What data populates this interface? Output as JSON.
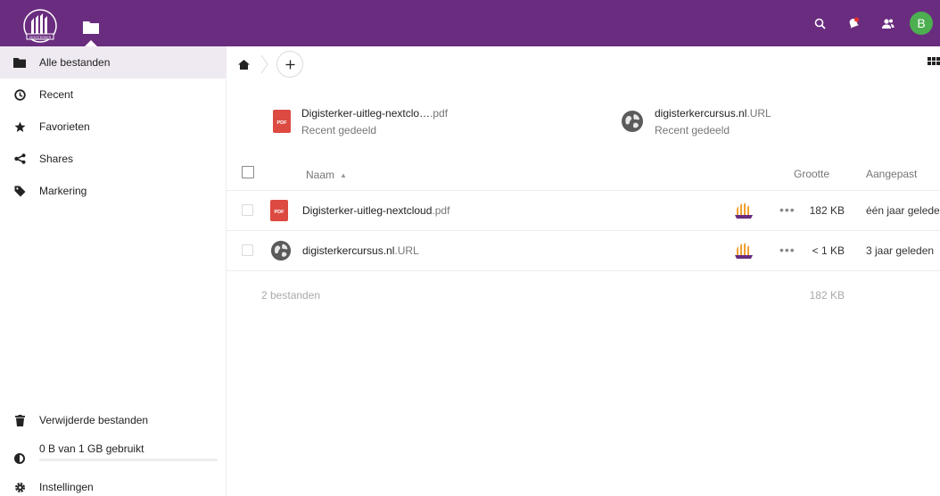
{
  "header": {
    "logo_text": "DIGISTERKER",
    "avatar_initial": "B",
    "icons": [
      "search-icon",
      "notifications-icon",
      "contacts-icon"
    ],
    "colors": {
      "primary": "#6a2c7f",
      "avatar": "#4caf50",
      "notification_dot": "#e9322d"
    }
  },
  "sidebar": {
    "items": [
      {
        "label": "Alle bestanden",
        "icon": "folder-icon",
        "active": true
      },
      {
        "label": "Recent",
        "icon": "clock-icon"
      },
      {
        "label": "Favorieten",
        "icon": "star-icon"
      },
      {
        "label": "Shares",
        "icon": "share-icon"
      },
      {
        "label": "Markering",
        "icon": "tag-icon"
      }
    ],
    "deleted_label": "Verwijderde bestanden",
    "quota_label": "0 B van 1 GB gebruikt",
    "quota_fraction": 0,
    "settings_label": "Instellingen"
  },
  "recent": [
    {
      "name": "Digisterker-uitleg-nextclo…",
      "ext": ".pdf",
      "sub": "Recent gedeeld",
      "icon": "pdf-icon"
    },
    {
      "name": "digisterkercursus.nl",
      "ext": ".URL",
      "sub": "Recent gedeeld",
      "icon": "globe-icon"
    }
  ],
  "table": {
    "headers": {
      "name": "Naam",
      "size": "Grootte",
      "modified": "Aangepast"
    },
    "rows": [
      {
        "name": "Digisterker-uitleg-nextcloud",
        "ext": ".pdf",
        "size": "182 KB",
        "modified": "één jaar geleden",
        "icon": "pdf-icon"
      },
      {
        "name": "digisterkercursus.nl",
        "ext": ".URL",
        "size": "< 1 KB",
        "modified": "3 jaar geleden",
        "icon": "globe-icon"
      }
    ],
    "summary": {
      "count": "2 bestanden",
      "size": "182 KB"
    }
  }
}
